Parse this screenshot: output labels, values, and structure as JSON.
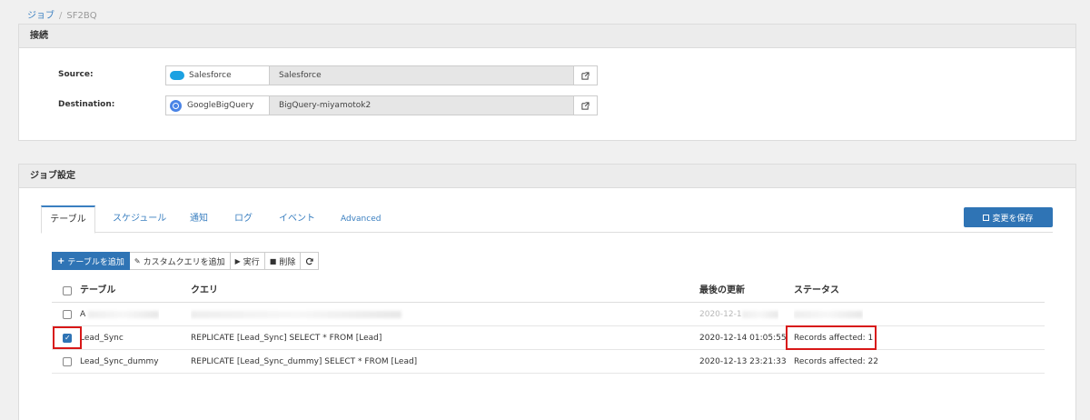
{
  "breadcrumb": {
    "parent": "ジョブ",
    "current": "SF2BQ"
  },
  "connection": {
    "title": "接続",
    "source": {
      "label": "Source:",
      "type": "Salesforce",
      "name": "Salesforce"
    },
    "destination": {
      "label": "Destination:",
      "type": "GoogleBigQuery",
      "name": "BigQuery-miyamotok2"
    }
  },
  "job": {
    "title": "ジョブ設定",
    "tabs": [
      "テーブル",
      "スケジュール",
      "通知",
      "ログ",
      "イベント",
      "Advanced"
    ],
    "save_label": "変更を保存",
    "toolbar": {
      "add_table": "テーブルを追加",
      "add_custom_query": "カスタムクエリを追加",
      "run": "実行",
      "delete": "削除"
    },
    "table": {
      "headers": {
        "table": "テーブル",
        "query": "クエリ",
        "updated": "最後の更新",
        "status": "ステータス"
      },
      "rows": [
        {
          "name": "A",
          "query": "",
          "updated": "2020-12-1",
          "status": "",
          "checked": false,
          "obscured": true
        },
        {
          "name": "Lead_Sync",
          "query": "REPLICATE [Lead_Sync] SELECT * FROM [Lead]",
          "updated": "2020-12-14 01:05:55",
          "status": "Records affected: 1",
          "checked": true
        },
        {
          "name": "Lead_Sync_dummy",
          "query": "REPLICATE [Lead_Sync_dummy] SELECT * FROM [Lead]",
          "updated": "2020-12-13 23:21:33",
          "status": "Records affected: 22",
          "checked": false
        }
      ]
    }
  },
  "colors": {
    "accent": "#2f74b5",
    "link": "#3a7fc0",
    "highlight": "#d81818"
  },
  "icons": {
    "salesforce": "salesforce-cloud-icon",
    "bigquery": "bigquery-icon",
    "external": "external-link-icon",
    "refresh": "refresh-icon"
  }
}
